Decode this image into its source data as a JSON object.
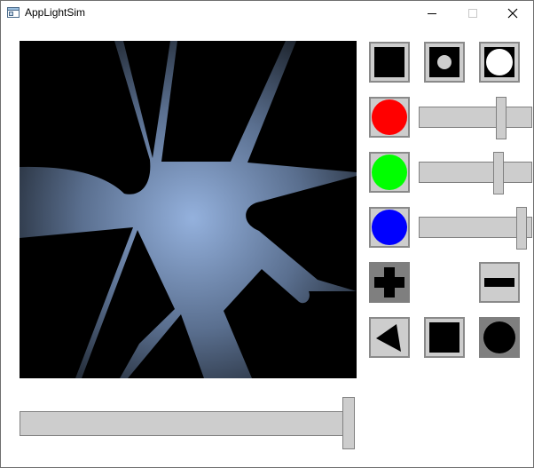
{
  "window": {
    "title": "AppLightSim",
    "icon": "app-window-icon",
    "controls": [
      "minimize-icon",
      "maximize-icon",
      "close-icon"
    ]
  },
  "viewport": {
    "light_color": "#90aedd",
    "background_color": "#000000"
  },
  "buttons": {
    "row1": [
      "light-off-icon",
      "small-light-icon",
      "large-light-icon"
    ],
    "color_buttons": [
      {
        "icon": "red-circle-icon",
        "color": "#ff0000"
      },
      {
        "icon": "green-circle-icon",
        "color": "#00ff00"
      },
      {
        "icon": "blue-circle-icon",
        "color": "#0000ff"
      }
    ],
    "zoom": [
      "plus-icon",
      "minus-icon"
    ],
    "shapes": [
      "triangle-shape-icon",
      "square-shape-icon",
      "circle-shape-icon"
    ]
  },
  "sliders": {
    "red_level": 0.75,
    "green_level": 0.72,
    "blue_level": 0.95,
    "main_level": 1.0
  }
}
